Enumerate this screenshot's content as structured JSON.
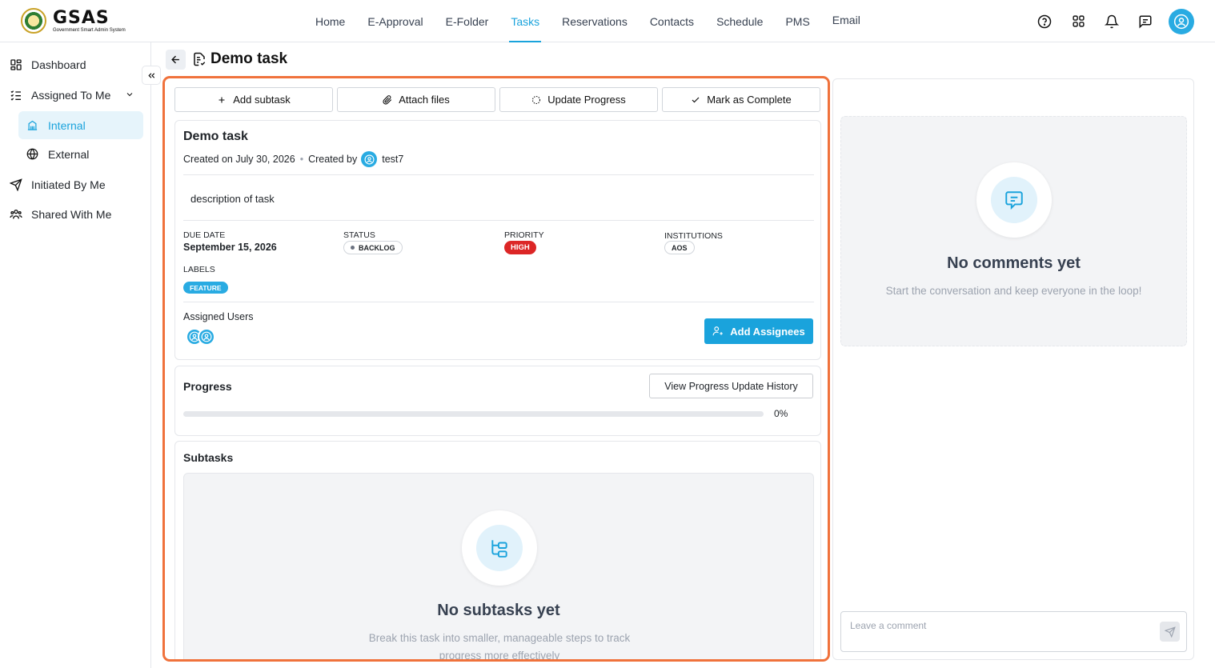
{
  "app": {
    "logo_name": "GSAS",
    "logo_subtitle": "Government Smart Admin System"
  },
  "nav": {
    "items": [
      {
        "label": "Home"
      },
      {
        "label": "E-Approval"
      },
      {
        "label": "E-Folder"
      },
      {
        "label": "Tasks",
        "active": true
      },
      {
        "label": "Reservations"
      },
      {
        "label": "Contacts"
      },
      {
        "label": "Schedule"
      },
      {
        "label": "PMS"
      },
      {
        "label": "Email"
      }
    ],
    "icons": [
      "help-icon",
      "apps-grid-icon",
      "bell-icon",
      "chat-icon",
      "user-avatar"
    ]
  },
  "sidebar": {
    "dashboard": "Dashboard",
    "assigned_to_me": "Assigned To Me",
    "internal": "Internal",
    "external": "External",
    "initiated_by_me": "Initiated By Me",
    "shared_with_me": "Shared With Me"
  },
  "header": {
    "title": "Demo task"
  },
  "actions": {
    "add_subtask": "Add subtask",
    "attach_files": "Attach files",
    "update_progress": "Update Progress",
    "mark_complete": "Mark as Complete"
  },
  "task": {
    "name": "Demo task",
    "created_on": "Created on July 30, 2026",
    "created_by_label": "Created by",
    "created_by": "test7",
    "description": "description of task",
    "due_date_label": "DUE DATE",
    "due_date": "September 15, 2026",
    "status_label": "STATUS",
    "status": "BACKLOG",
    "priority_label": "PRIORITY",
    "priority": "HIGH",
    "institutions_label": "INSTITUTIONS",
    "institution": "AOS",
    "labels_label": "LABELS",
    "label": "FEATURE",
    "assigned_users_label": "Assigned Users",
    "add_assignees": "Add Assignees"
  },
  "progress": {
    "title": "Progress",
    "history_button": "View Progress Update History",
    "value": 0,
    "value_text": "0%"
  },
  "subtasks": {
    "title": "Subtasks",
    "empty_title": "No subtasks yet",
    "empty_text": "Break this task into smaller, manageable steps to track progress more effectively"
  },
  "comments": {
    "empty_title": "No comments yet",
    "empty_text": "Start the conversation and keep everyone in the loop!",
    "input_placeholder": "Leave a comment"
  },
  "colors": {
    "accent": "#1aa3dc",
    "highlight": "#f0723c",
    "priority_high": "#dc2626"
  }
}
